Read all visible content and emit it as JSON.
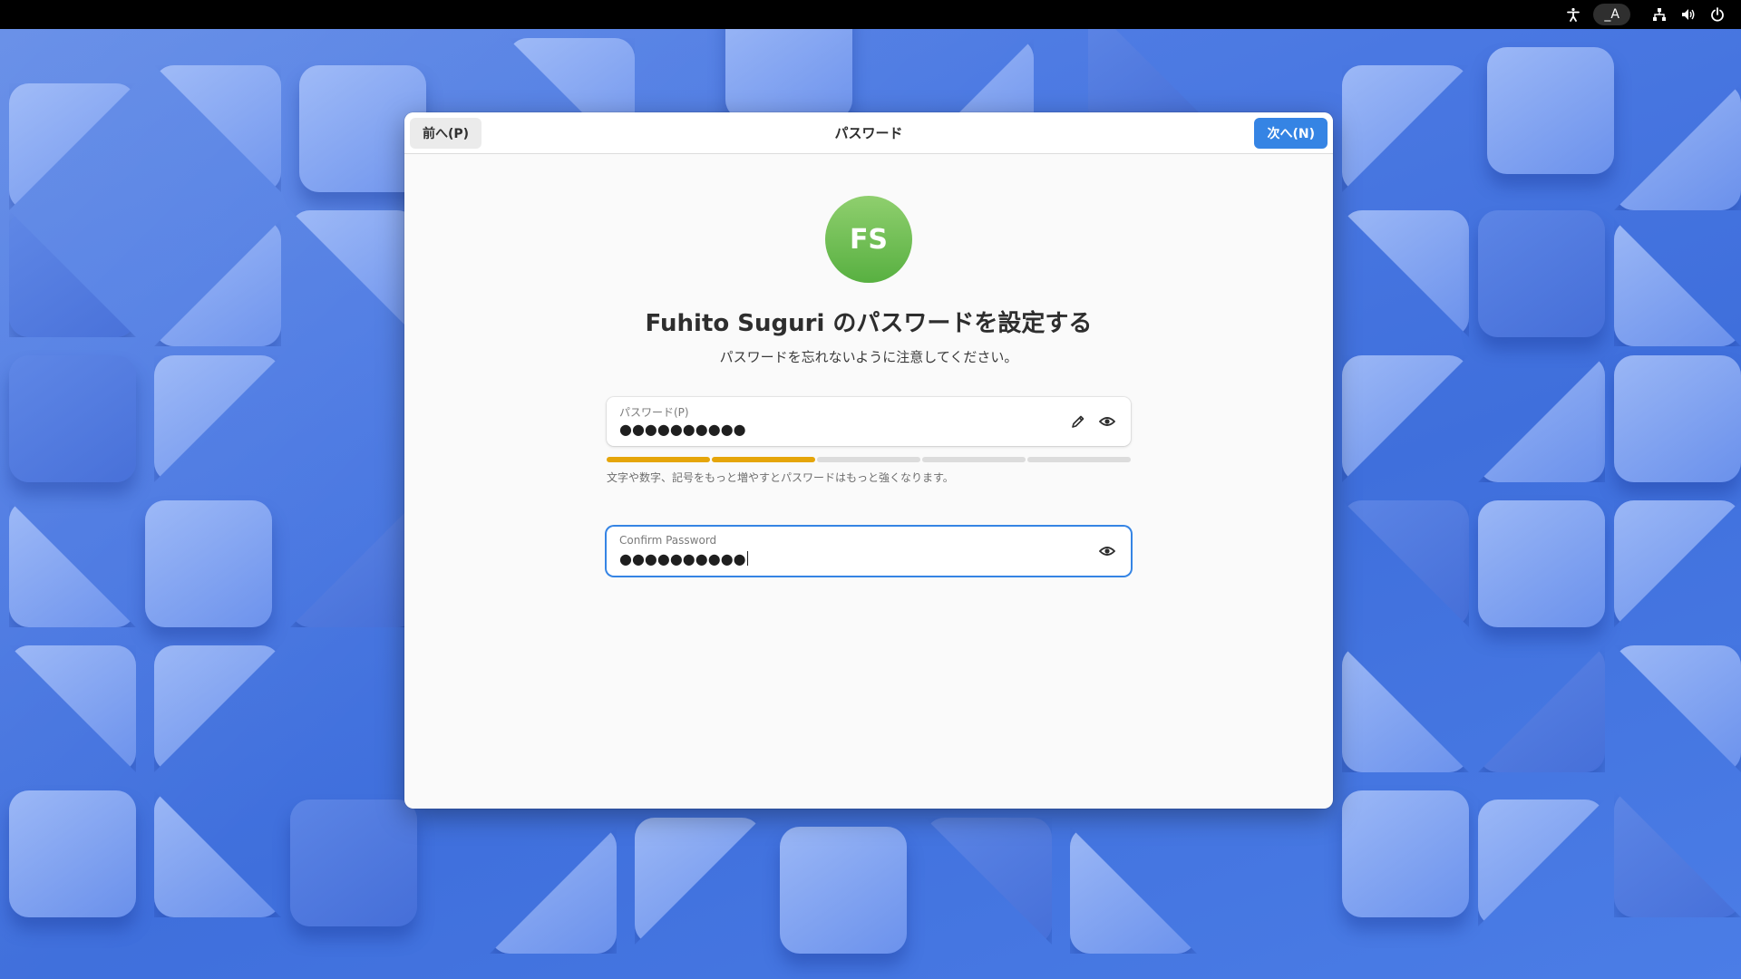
{
  "topbar": {
    "input_source": "_A",
    "icons": [
      "accessibility-icon",
      "network-icon",
      "volume-icon",
      "power-icon"
    ]
  },
  "window": {
    "title": "パスワード",
    "prev_label": "前へ(P)",
    "next_label": "次へ(N)"
  },
  "account": {
    "initials": "FS",
    "heading": "Fuhito Suguri のパスワードを設定する",
    "subtitle": "パスワードを忘れないように注意してください。"
  },
  "password": {
    "label": "パスワード(P)",
    "value": "●●●●●●●●●●",
    "strength_level": 0.4,
    "strength_segments_filled": 2,
    "strength_segments_total": 5,
    "hint": "文字や数字、記号をもっと増やすとパスワードはもっと強くなります。"
  },
  "confirm": {
    "label": "Confirm Password",
    "value": "●●●●●●●●●●"
  },
  "colors": {
    "accent": "#3584e4",
    "strength": "#e5a50a",
    "avatar": "#6dbd52"
  }
}
